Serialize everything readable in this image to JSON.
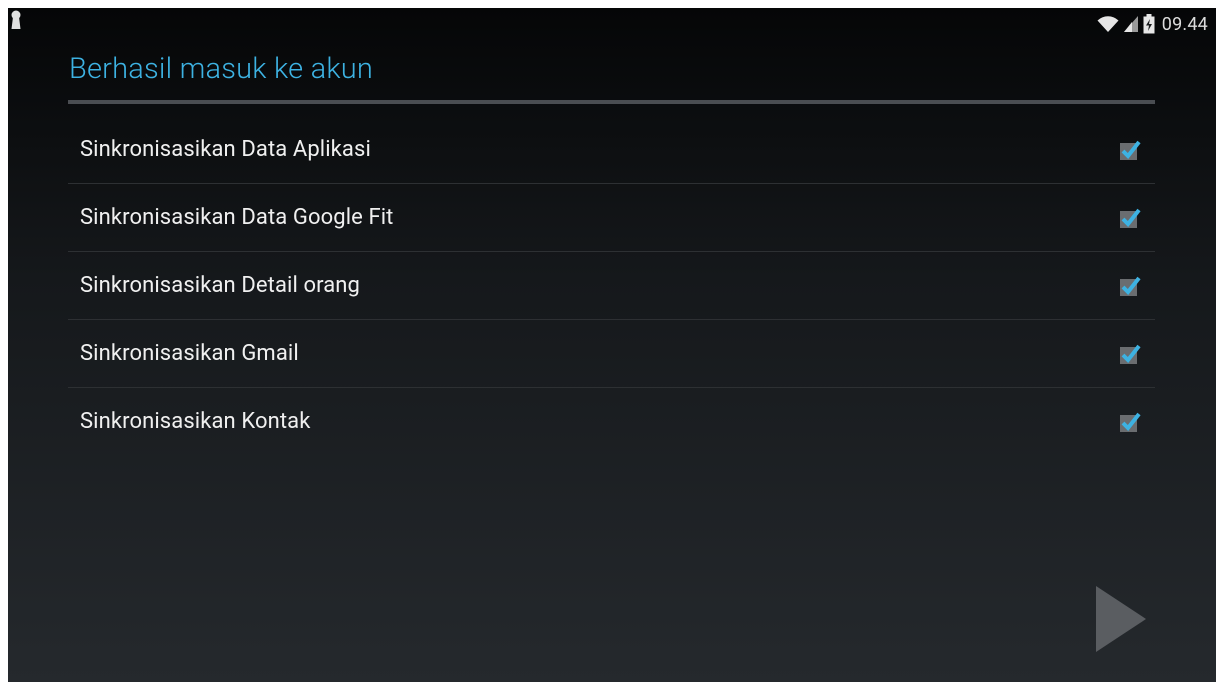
{
  "status_bar": {
    "time": "09.44",
    "icons": [
      "keyhole-icon",
      "wifi-icon",
      "signal-icon",
      "battery-charging-icon"
    ]
  },
  "title": "Berhasil masuk ke akun",
  "sync_items": [
    {
      "label": "Sinkronisasikan Data Aplikasi",
      "checked": true
    },
    {
      "label": "Sinkronisasikan Data Google Fit",
      "checked": true
    },
    {
      "label": "Sinkronisasikan Detail orang",
      "checked": true
    },
    {
      "label": "Sinkronisasikan Gmail",
      "checked": true
    },
    {
      "label": "Sinkronisasikan Kontak",
      "checked": true
    }
  ],
  "next_icon": "play-arrow-icon",
  "colors": {
    "accent": "#3db2e2",
    "text": "#f0f0f0",
    "divider": "#2d3033",
    "next_arrow": "#5a5d61"
  }
}
